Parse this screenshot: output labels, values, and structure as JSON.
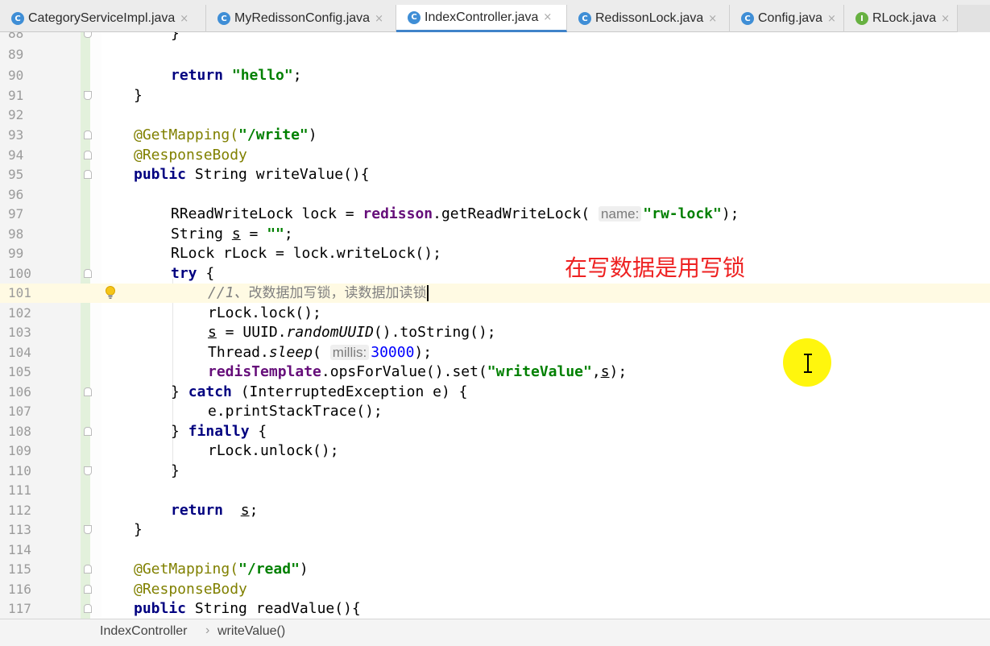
{
  "tabs": [
    {
      "label": "CategoryServiceImpl.java",
      "icon": "class-icon",
      "active": false
    },
    {
      "label": "MyRedissonConfig.java",
      "icon": "class-icon",
      "active": false
    },
    {
      "label": "IndexController.java",
      "icon": "class-icon",
      "active": true
    },
    {
      "label": "RedissonLock.java",
      "icon": "class-icon",
      "active": false
    },
    {
      "label": "Config.java",
      "icon": "class-icon",
      "active": false
    },
    {
      "label": "RLock.java",
      "icon": "interface-icon",
      "active": false
    }
  ],
  "icon_letters": {
    "class": "C",
    "interface": "I"
  },
  "close_glyph": "×",
  "editor": {
    "line_numbers": [
      "88",
      "89",
      "90",
      "91",
      "92",
      "93",
      "94",
      "95",
      "96",
      "97",
      "98",
      "99",
      "100",
      "101",
      "102",
      "103",
      "104",
      "105",
      "106",
      "107",
      "108",
      "109",
      "110",
      "111",
      "112",
      "113",
      "114",
      "115",
      "116",
      "117"
    ],
    "current_line": "101",
    "code": {
      "l88": "}",
      "l90_kw": "return",
      "l90_str": "\"hello\"",
      "l90_end": ";",
      "l91": "}",
      "l93_ann": "@GetMapping(",
      "l93_str": "\"/write\"",
      "l93_end": ")",
      "l94_ann": "@ResponseBody",
      "l95_kw": "public",
      "l95_rest": " String writeValue(){",
      "l97_a": "RReadWriteLock lock = ",
      "l97_field": "redisson",
      "l97_b": ".getReadWriteLock(",
      "l97_hint": "name:",
      "l97_str": "\"rw-lock\"",
      "l97_end": ");",
      "l98_a": "String ",
      "l98_var": "s",
      "l98_b": " = ",
      "l98_str": "\"\"",
      "l98_end": ";",
      "l99": "RLock rLock = lock.writeLock();",
      "l100_kw": "try",
      "l100_end": " {",
      "l101_cmt_num": "//1、",
      "l101_cmt_cn": "改数据加写锁，读数据加读锁",
      "l102": "rLock.lock();",
      "l103_var": "s",
      "l103_a": " = UUID.",
      "l103_it": "randomUUID",
      "l103_b": "().toString();",
      "l104_a": "Thread.",
      "l104_it": "sleep",
      "l104_b": "(",
      "l104_hint": "millis:",
      "l104_num": "30000",
      "l104_end": ");",
      "l105_field": "redisTemplate",
      "l105_a": ".opsForValue().set(",
      "l105_str": "\"writeValue\"",
      "l105_b": ",",
      "l105_var": "s",
      "l105_end": ");",
      "l106_a": "} ",
      "l106_kw": "catch",
      "l106_b": " (InterruptedException e) {",
      "l107": "e.printStackTrace();",
      "l108_a": "} ",
      "l108_kw": "finally",
      "l108_b": " {",
      "l109": "rLock.unlock();",
      "l110": "}",
      "l112_kw": "return",
      "l112_sp": "  ",
      "l112_var": "s",
      "l112_end": ";",
      "l113": "}",
      "l115_ann": "@GetMapping(",
      "l115_str": "\"/read\"",
      "l115_end": ")",
      "l116_ann": "@ResponseBody",
      "l117_kw": "public",
      "l117_rest": " String readValue(){"
    },
    "overlay_note": "在写数据是用写锁"
  },
  "breadcrumbs": {
    "class": "IndexController",
    "separator": "›",
    "method": "writeValue()"
  },
  "colors": {
    "keyword": "#000080",
    "string": "#008000",
    "annotation": "#808000",
    "field": "#660e7a",
    "number": "#0000ff",
    "comment": "#808080",
    "note": "#ee2222",
    "cursor_highlight": "#fff500"
  }
}
